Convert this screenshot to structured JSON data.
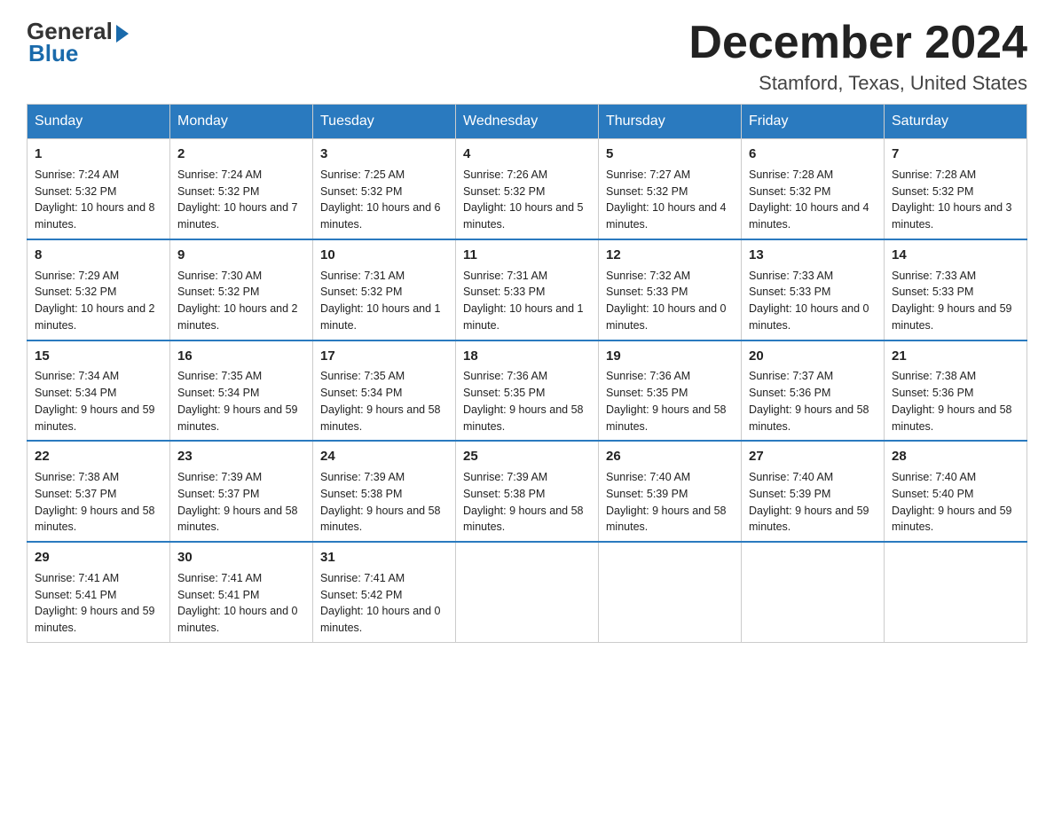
{
  "logo": {
    "general": "General",
    "blue": "Blue"
  },
  "title": "December 2024",
  "location": "Stamford, Texas, United States",
  "days_of_week": [
    "Sunday",
    "Monday",
    "Tuesday",
    "Wednesday",
    "Thursday",
    "Friday",
    "Saturday"
  ],
  "weeks": [
    [
      {
        "day": "1",
        "sunrise": "7:24 AM",
        "sunset": "5:32 PM",
        "daylight": "10 hours and 8 minutes."
      },
      {
        "day": "2",
        "sunrise": "7:24 AM",
        "sunset": "5:32 PM",
        "daylight": "10 hours and 7 minutes."
      },
      {
        "day": "3",
        "sunrise": "7:25 AM",
        "sunset": "5:32 PM",
        "daylight": "10 hours and 6 minutes."
      },
      {
        "day": "4",
        "sunrise": "7:26 AM",
        "sunset": "5:32 PM",
        "daylight": "10 hours and 5 minutes."
      },
      {
        "day": "5",
        "sunrise": "7:27 AM",
        "sunset": "5:32 PM",
        "daylight": "10 hours and 4 minutes."
      },
      {
        "day": "6",
        "sunrise": "7:28 AM",
        "sunset": "5:32 PM",
        "daylight": "10 hours and 4 minutes."
      },
      {
        "day": "7",
        "sunrise": "7:28 AM",
        "sunset": "5:32 PM",
        "daylight": "10 hours and 3 minutes."
      }
    ],
    [
      {
        "day": "8",
        "sunrise": "7:29 AM",
        "sunset": "5:32 PM",
        "daylight": "10 hours and 2 minutes."
      },
      {
        "day": "9",
        "sunrise": "7:30 AM",
        "sunset": "5:32 PM",
        "daylight": "10 hours and 2 minutes."
      },
      {
        "day": "10",
        "sunrise": "7:31 AM",
        "sunset": "5:32 PM",
        "daylight": "10 hours and 1 minute."
      },
      {
        "day": "11",
        "sunrise": "7:31 AM",
        "sunset": "5:33 PM",
        "daylight": "10 hours and 1 minute."
      },
      {
        "day": "12",
        "sunrise": "7:32 AM",
        "sunset": "5:33 PM",
        "daylight": "10 hours and 0 minutes."
      },
      {
        "day": "13",
        "sunrise": "7:33 AM",
        "sunset": "5:33 PM",
        "daylight": "10 hours and 0 minutes."
      },
      {
        "day": "14",
        "sunrise": "7:33 AM",
        "sunset": "5:33 PM",
        "daylight": "9 hours and 59 minutes."
      }
    ],
    [
      {
        "day": "15",
        "sunrise": "7:34 AM",
        "sunset": "5:34 PM",
        "daylight": "9 hours and 59 minutes."
      },
      {
        "day": "16",
        "sunrise": "7:35 AM",
        "sunset": "5:34 PM",
        "daylight": "9 hours and 59 minutes."
      },
      {
        "day": "17",
        "sunrise": "7:35 AM",
        "sunset": "5:34 PM",
        "daylight": "9 hours and 58 minutes."
      },
      {
        "day": "18",
        "sunrise": "7:36 AM",
        "sunset": "5:35 PM",
        "daylight": "9 hours and 58 minutes."
      },
      {
        "day": "19",
        "sunrise": "7:36 AM",
        "sunset": "5:35 PM",
        "daylight": "9 hours and 58 minutes."
      },
      {
        "day": "20",
        "sunrise": "7:37 AM",
        "sunset": "5:36 PM",
        "daylight": "9 hours and 58 minutes."
      },
      {
        "day": "21",
        "sunrise": "7:38 AM",
        "sunset": "5:36 PM",
        "daylight": "9 hours and 58 minutes."
      }
    ],
    [
      {
        "day": "22",
        "sunrise": "7:38 AM",
        "sunset": "5:37 PM",
        "daylight": "9 hours and 58 minutes."
      },
      {
        "day": "23",
        "sunrise": "7:39 AM",
        "sunset": "5:37 PM",
        "daylight": "9 hours and 58 minutes."
      },
      {
        "day": "24",
        "sunrise": "7:39 AM",
        "sunset": "5:38 PM",
        "daylight": "9 hours and 58 minutes."
      },
      {
        "day": "25",
        "sunrise": "7:39 AM",
        "sunset": "5:38 PM",
        "daylight": "9 hours and 58 minutes."
      },
      {
        "day": "26",
        "sunrise": "7:40 AM",
        "sunset": "5:39 PM",
        "daylight": "9 hours and 58 minutes."
      },
      {
        "day": "27",
        "sunrise": "7:40 AM",
        "sunset": "5:39 PM",
        "daylight": "9 hours and 59 minutes."
      },
      {
        "day": "28",
        "sunrise": "7:40 AM",
        "sunset": "5:40 PM",
        "daylight": "9 hours and 59 minutes."
      }
    ],
    [
      {
        "day": "29",
        "sunrise": "7:41 AM",
        "sunset": "5:41 PM",
        "daylight": "9 hours and 59 minutes."
      },
      {
        "day": "30",
        "sunrise": "7:41 AM",
        "sunset": "5:41 PM",
        "daylight": "10 hours and 0 minutes."
      },
      {
        "day": "31",
        "sunrise": "7:41 AM",
        "sunset": "5:42 PM",
        "daylight": "10 hours and 0 minutes."
      },
      null,
      null,
      null,
      null
    ]
  ],
  "labels": {
    "sunrise": "Sunrise:",
    "sunset": "Sunset:",
    "daylight": "Daylight:"
  }
}
